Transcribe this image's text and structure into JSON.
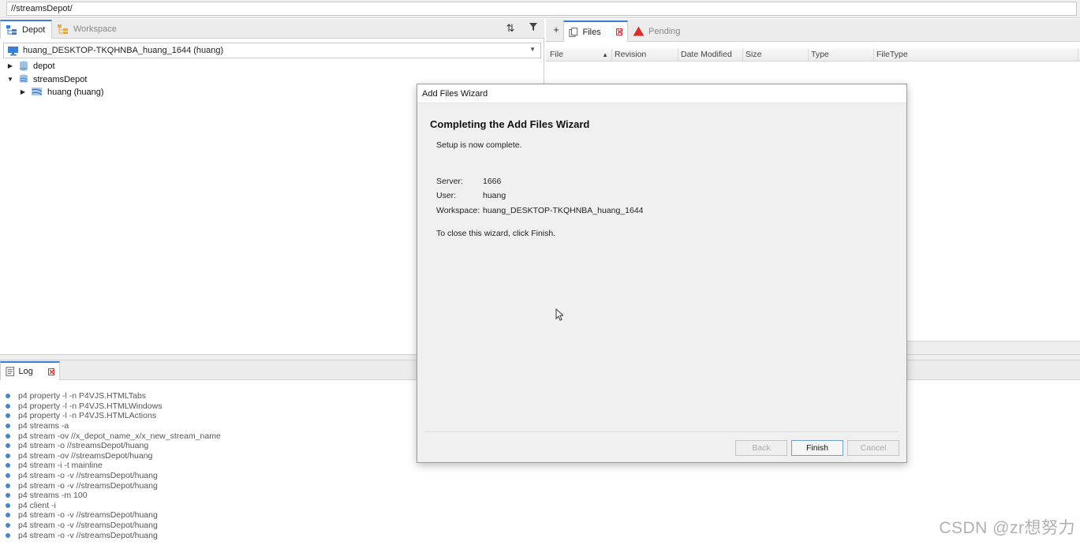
{
  "address": {
    "path": "//streamsDepot/"
  },
  "left": {
    "tabs": [
      {
        "label": "Depot",
        "icon": "depot-tab-icon"
      },
      {
        "label": "Workspace",
        "icon": "workspace-tab-icon"
      }
    ],
    "toolbar": {
      "sort_icon": "sort-icon",
      "filter_icon": "filter-icon"
    },
    "client_select": "huang_DESKTOP-TKQHNBA_huang_1644 (huang)",
    "tree": [
      {
        "label": "depot",
        "expanded": false
      },
      {
        "label": "streamsDepot",
        "expanded": true
      },
      {
        "label": "huang (huang)",
        "expanded": false
      }
    ]
  },
  "right": {
    "tabs": [
      {
        "label": "Files"
      },
      {
        "label": "Pending"
      }
    ],
    "columns": [
      "File",
      "Revision",
      "Date Modified",
      "Size",
      "Type",
      "FileType"
    ]
  },
  "log": {
    "tab_label": "Log",
    "lines": [
      "p4 property -l -n P4VJS.HTMLTabs",
      "p4 property -l -n P4VJS.HTMLWindows",
      "p4 property -l -n P4VJS.HTMLActions",
      "p4 streams -a",
      "p4 stream -ov //x_depot_name_x/x_new_stream_name",
      "p4 stream -o //streamsDepot/huang",
      "p4 stream -ov //streamsDepot/huang",
      "p4 stream -i -t mainline",
      "p4 stream -o -v //streamsDepot/huang",
      "p4 stream -o -v //streamsDepot/huang",
      "p4 streams -m 100",
      "p4 client -i",
      "p4 stream -o -v //streamsDepot/huang",
      "p4 stream -o -v //streamsDepot/huang",
      "p4 stream -o -v //streamsDepot/huang"
    ]
  },
  "dialog": {
    "title": "Add Files Wizard",
    "heading": "Completing the Add Files Wizard",
    "intro": "Setup is now complete.",
    "server_label": "Server:",
    "server_value": "1666",
    "user_label": "User:",
    "user_value": "huang",
    "workspace_label": "Workspace:",
    "workspace_value": "huang_DESKTOP-TKQHNBA_huang_1644",
    "close_hint": "To close this wizard, click Finish.",
    "buttons": {
      "back": "Back",
      "finish": "Finish",
      "cancel": "Cancel"
    }
  },
  "watermark": "CSDN @zr想努力",
  "colors": {
    "accent": "#3b7fd4",
    "log_dot": "#4a86c5",
    "pending_icon": "#d9302c",
    "close_x": "#d23b3b"
  }
}
